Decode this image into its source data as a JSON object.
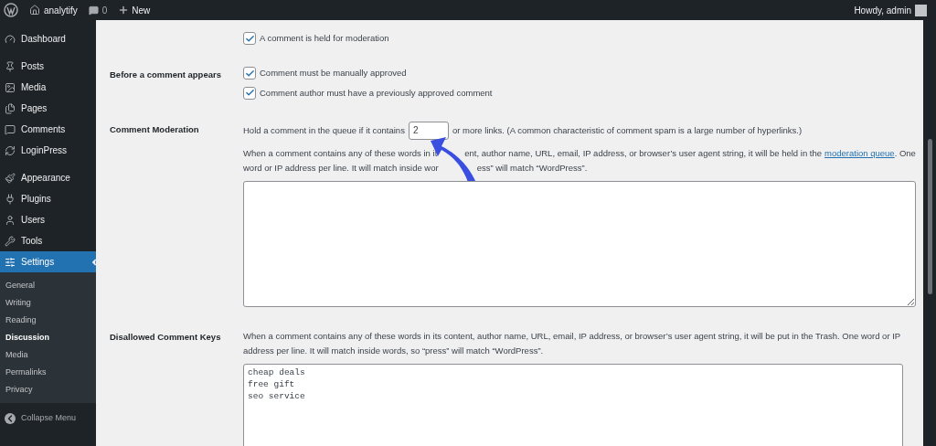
{
  "admin_bar": {
    "site_name": "analytify",
    "comments_count": "0",
    "new_label": "New",
    "greeting": "Howdy, admin"
  },
  "sidebar": {
    "items": [
      {
        "label": "Dashboard",
        "selected": false
      },
      {
        "label": "Posts",
        "selected": false
      },
      {
        "label": "Media",
        "selected": false
      },
      {
        "label": "Pages",
        "selected": false
      },
      {
        "label": "Comments",
        "selected": false
      },
      {
        "label": "LoginPress",
        "selected": false
      },
      {
        "label": "Appearance",
        "selected": false
      },
      {
        "label": "Plugins",
        "selected": false
      },
      {
        "label": "Users",
        "selected": false
      },
      {
        "label": "Tools",
        "selected": false
      },
      {
        "label": "Settings",
        "selected": true,
        "children": [
          {
            "label": "General",
            "selected": false
          },
          {
            "label": "Writing",
            "selected": false
          },
          {
            "label": "Reading",
            "selected": false
          },
          {
            "label": "Discussion",
            "selected": true
          },
          {
            "label": "Media",
            "selected": false
          },
          {
            "label": "Permalinks",
            "selected": false
          },
          {
            "label": "Privacy",
            "selected": false
          }
        ]
      }
    ],
    "collapse_label": "Collapse Menu"
  },
  "settings": [
    {
      "kind": "checkboxes",
      "options": [
        {
          "label": "A comment is held for moderation",
          "checked": true
        }
      ]
    },
    {
      "kind": "checkboxes",
      "label": "Before a comment appears",
      "options": [
        {
          "label": "Comment must be manually approved",
          "checked": true
        },
        {
          "label": "Comment author must have a previously approved comment",
          "checked": true
        }
      ]
    },
    {
      "kind": "moderation",
      "label": "Comment Moderation",
      "links_before": "Hold a comment in the queue if it contains",
      "links_value": "2",
      "links_after": "or more links. (A common characteristic of comment spam is a large number of hyperlinks.)",
      "line_1": [
        "When a comment contains any of these words in it",
        "ent, author name, URL, email, IP address, or browser’s user agent string, it will be held in the"
      ],
      "link": "moderation queue",
      "line_1_end": ". One",
      "line_2": [
        "word or IP address per line. It will match inside wor",
        "ess” will match “WordPress”."
      ]
    },
    {
      "kind": "keys",
      "label": "Disallowed Comment Keys",
      "description": "When a comment contains any of these words in its content, author name, URL, email, IP address, or browser’s user agent string, it will be put in the Trash. One word or IP address per line. It will match inside words, so “press” will match “WordPress”.",
      "keys": "cheap deals\nfree gift\nseo service"
    }
  ]
}
